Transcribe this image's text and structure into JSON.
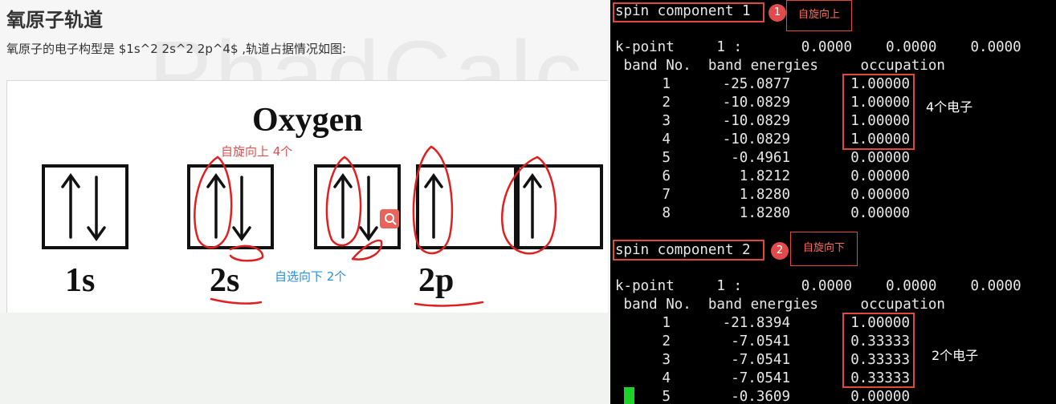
{
  "article": {
    "title": "氧原子轨道",
    "intro": "氧原子的电子构型是 $1s^2 2s^2 2p^4$ ,轨道占据情况如图:",
    "watermark": "PhadCalc",
    "figure": {
      "title": "Oxygen",
      "orbitals": [
        {
          "label": "1s",
          "boxes": [
            {
              "arrows": [
                "up",
                "down"
              ]
            }
          ]
        },
        {
          "label": "2s",
          "boxes": [
            {
              "arrows": [
                "up",
                "down"
              ]
            }
          ]
        },
        {
          "label": "2p",
          "boxes": [
            {
              "arrows": [
                "up",
                "down"
              ]
            },
            {
              "arrows": [
                "up"
              ]
            },
            {
              "arrows": [
                "up"
              ]
            }
          ]
        }
      ],
      "annotation_spin_up": "自旋向上 4个",
      "annotation_spin_down": "自选向下 2个",
      "annotation_up_color": "#e05050",
      "annotation_down_color": "#2b8fe0",
      "ink_color": "#e02020"
    }
  },
  "terminal": {
    "spin1": {
      "header": "spin component 1",
      "badge": "1",
      "tag": "自旋向上",
      "kpoint": "k-point     1 :       0.0000    0.0000    0.0000",
      "columns": " band No.  band energies     occupation",
      "rows": [
        {
          "band": "1",
          "energy": "-25.0877",
          "occ": "1.00000"
        },
        {
          "band": "2",
          "energy": "-10.0829",
          "occ": "1.00000"
        },
        {
          "band": "3",
          "energy": "-10.0829",
          "occ": "1.00000"
        },
        {
          "band": "4",
          "energy": "-10.0829",
          "occ": "1.00000"
        },
        {
          "band": "5",
          "energy": "-0.4961",
          "occ": "0.00000"
        },
        {
          "band": "6",
          "energy": "1.8212",
          "occ": "0.00000"
        },
        {
          "band": "7",
          "energy": "1.8280",
          "occ": "0.00000"
        },
        {
          "band": "8",
          "energy": "1.8280",
          "occ": "0.00000"
        }
      ],
      "count": "4个电子"
    },
    "spin2": {
      "header": "spin component 2",
      "badge": "2",
      "tag": "自旋向下",
      "kpoint": "k-point     1 :       0.0000    0.0000    0.0000",
      "columns": " band No.  band energies     occupation",
      "rows": [
        {
          "band": "1",
          "energy": "-21.8394",
          "occ": "1.00000"
        },
        {
          "band": "2",
          "energy": "-7.0541",
          "occ": "0.33333"
        },
        {
          "band": "3",
          "energy": "-7.0541",
          "occ": "0.33333"
        },
        {
          "band": "4",
          "energy": "-7.0541",
          "occ": "0.33333"
        },
        {
          "band": "5",
          "energy": "-0.3609",
          "occ": "0.00000"
        }
      ],
      "count": "2个电子"
    },
    "box_color": "#e0483a",
    "cursor_color": "#1fd22a"
  }
}
